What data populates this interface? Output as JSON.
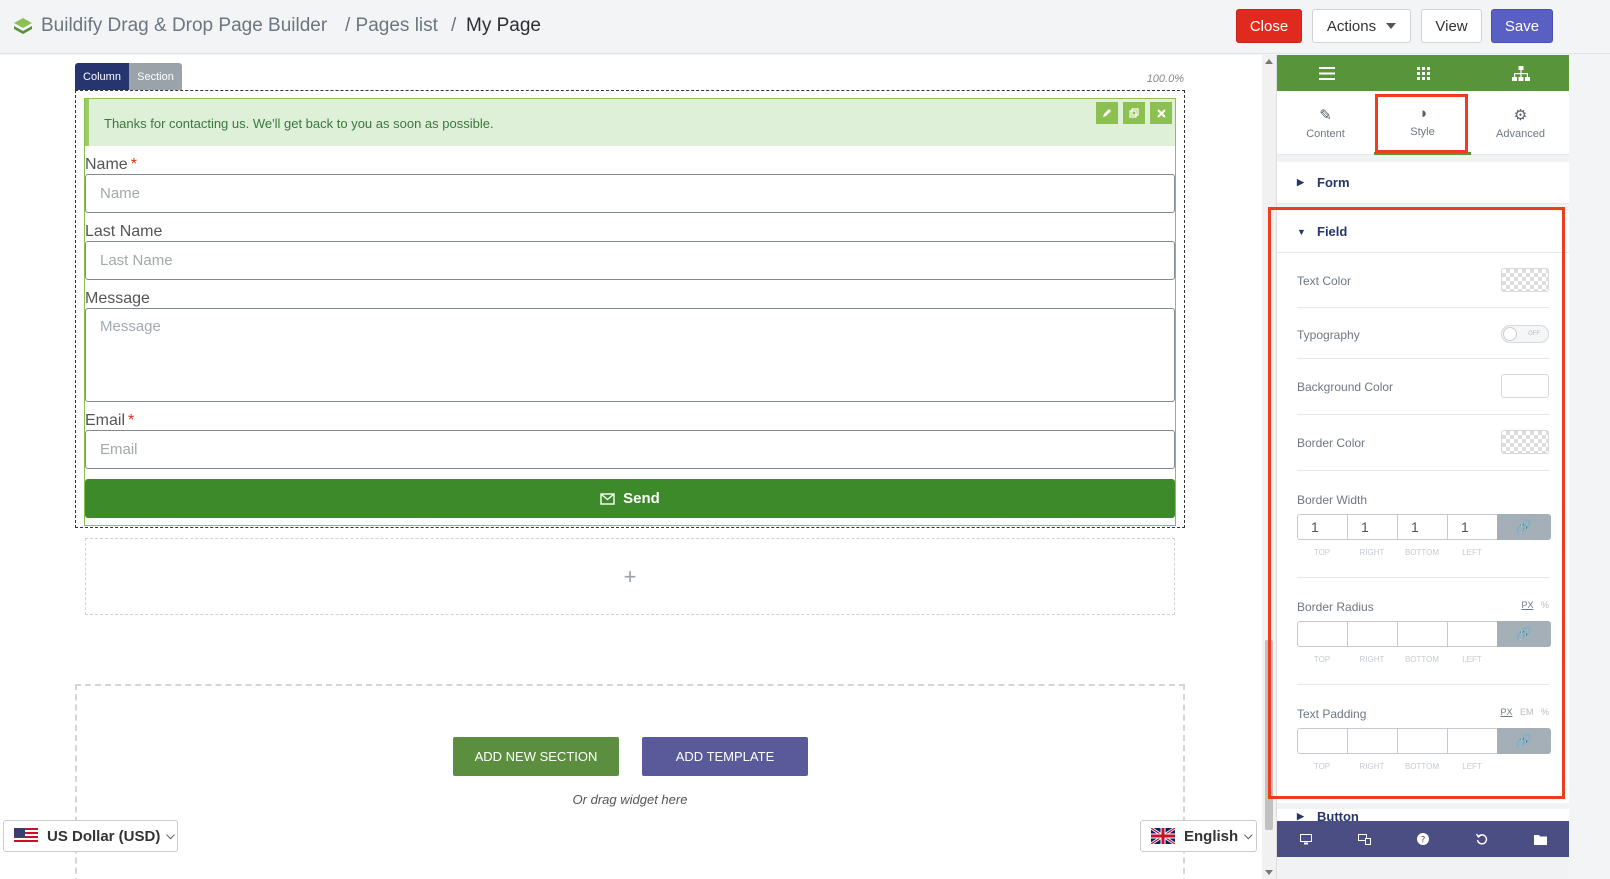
{
  "header": {
    "breadcrumb": {
      "app": "Buildify Drag & Drop Page Builder",
      "pages": "/ Pages list",
      "separator": "/",
      "current": "My Page"
    },
    "buttons": {
      "close": "Close",
      "actions": "Actions",
      "view": "View",
      "save": "Save"
    }
  },
  "canvas": {
    "element_tabs": {
      "column": "Column",
      "section": "Section"
    },
    "zoom": "100.0%",
    "success_message": "Thanks for contacting us. We'll get back to you as soon as possible.",
    "form": {
      "fields": [
        {
          "label": "Name",
          "placeholder": "Name",
          "required": "*"
        },
        {
          "label": "Last Name",
          "placeholder": "Last Name"
        },
        {
          "label": "Message",
          "placeholder": "Message"
        },
        {
          "label": "Email",
          "placeholder": "Email",
          "required": "*"
        }
      ],
      "submit": "Send"
    },
    "empty_column_plus": "+",
    "add_new_section": "ADD NEW SECTION",
    "add_template": "ADD TEMPLATE",
    "drag_hint": "Or drag widget here"
  },
  "footer": {
    "currency": "US Dollar (USD)",
    "language": "English"
  },
  "panel": {
    "tabs": [
      {
        "label": "Content",
        "icon": "pencil-icon"
      },
      {
        "label": "Style",
        "icon": "half-circle-icon"
      },
      {
        "label": "Advanced",
        "icon": "gear-icon"
      }
    ],
    "sections": {
      "form": "Form",
      "field": "Field",
      "button": "Button"
    },
    "controls": {
      "text_color": "Text Color",
      "typography": "Typography",
      "typography_toggle": "OFF",
      "background_color": "Background Color",
      "border_color": "Border Color",
      "border_width": "Border Width",
      "border_width_values": [
        "1",
        "1",
        "1",
        "1"
      ],
      "border_radius": "Border Radius",
      "text_padding": "Text Padding",
      "dim_labels": [
        "TOP",
        "RIGHT",
        "BOTTOM",
        "LEFT"
      ],
      "unit_px": "PX",
      "unit_em": "EM",
      "unit_pct": "%"
    }
  },
  "colors": {
    "accent_green": "#58943a",
    "send_green": "#3d8a2b",
    "close_red": "#e02a1d",
    "save_purple": "#5a5fc3",
    "highlight_red": "#f03b20"
  }
}
